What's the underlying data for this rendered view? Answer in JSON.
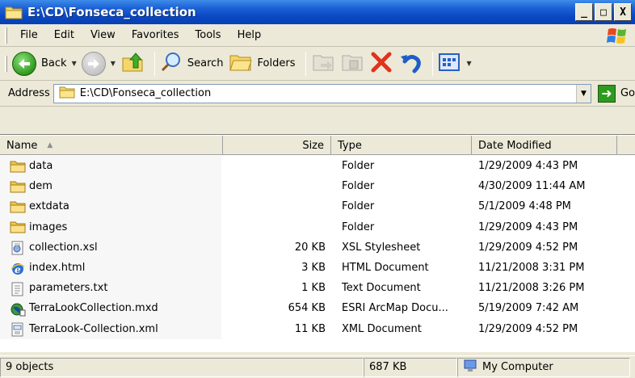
{
  "window": {
    "title": "E:\\CD\\Fonseca_collection",
    "buttons": [
      "_",
      "□",
      "X"
    ]
  },
  "menu": [
    "File",
    "Edit",
    "View",
    "Favorites",
    "Tools",
    "Help"
  ],
  "toolbar": {
    "back_label": "Back",
    "search_label": "Search",
    "folders_label": "Folders"
  },
  "address": {
    "label": "Address",
    "value": "E:\\CD\\Fonseca_collection",
    "go_label": "Go"
  },
  "columns": {
    "name": "Name",
    "size": "Size",
    "type": "Type",
    "date": "Date Modified"
  },
  "files": [
    {
      "name": "data",
      "size": "",
      "type": "Folder",
      "date": "1/29/2009 4:43 PM",
      "icon": "folder-icon"
    },
    {
      "name": "dem",
      "size": "",
      "type": "Folder",
      "date": "4/30/2009 11:44 AM",
      "icon": "folder-icon"
    },
    {
      "name": "extdata",
      "size": "",
      "type": "Folder",
      "date": "5/1/2009 4:48 PM",
      "icon": "folder-icon"
    },
    {
      "name": "images",
      "size": "",
      "type": "Folder",
      "date": "1/29/2009 4:43 PM",
      "icon": "folder-icon"
    },
    {
      "name": "collection.xsl",
      "size": "20 KB",
      "type": "XSL Stylesheet",
      "date": "1/29/2009 4:52 PM",
      "icon": "xsl-file-icon"
    },
    {
      "name": "index.html",
      "size": "3 KB",
      "type": "HTML Document",
      "date": "11/21/2008 3:31 PM",
      "icon": "html-file-icon"
    },
    {
      "name": "parameters.txt",
      "size": "1 KB",
      "type": "Text Document",
      "date": "11/21/2008 3:26 PM",
      "icon": "text-file-icon"
    },
    {
      "name": "TerraLookCollection.mxd",
      "size": "654 KB",
      "type": "ESRI ArcMap Docu...",
      "date": "5/19/2009 7:42 AM",
      "icon": "arcmap-file-icon"
    },
    {
      "name": "TerraLook-Collection.xml",
      "size": "11 KB",
      "type": "XML Document",
      "date": "1/29/2009 4:52 PM",
      "icon": "xml-file-icon"
    }
  ],
  "status": {
    "objects": "9 objects",
    "size": "687 KB",
    "location": "My Computer"
  }
}
